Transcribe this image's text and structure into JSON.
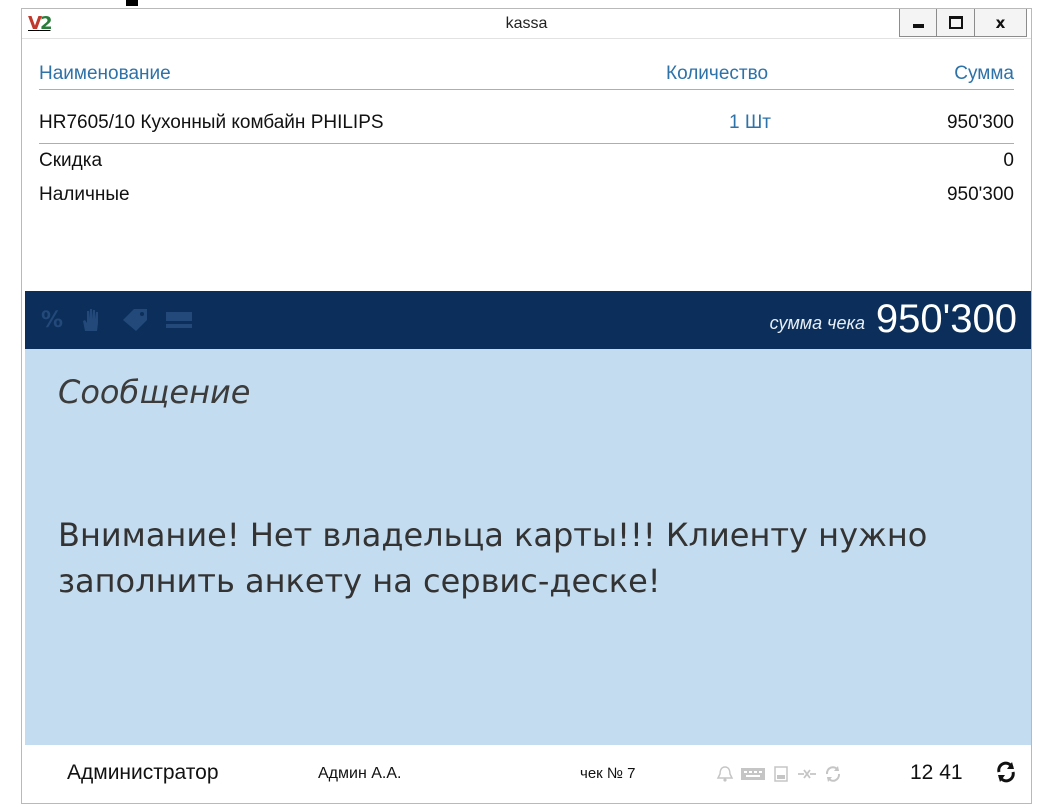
{
  "window": {
    "title": "kassa",
    "app_icon_text": "V2",
    "close_label": "x"
  },
  "table": {
    "headers": {
      "name": "Наименование",
      "quantity": "Количество",
      "sum": "Сумма"
    },
    "rows": [
      {
        "name": "HR7605/10 Кухонный комбайн PHILIPS",
        "quantity": "1 Шт",
        "sum": "950'300"
      },
      {
        "name": "Скидка",
        "quantity": "",
        "sum": "0"
      },
      {
        "name": "Наличные",
        "quantity": "",
        "sum": "950'300"
      }
    ]
  },
  "status_bar": {
    "icons": [
      "percent-icon",
      "hand-icon",
      "discount-tag-icon",
      "card-icon"
    ],
    "percent_glyph": "%",
    "total_label": "сумма чека",
    "total_value": "950'300"
  },
  "message": {
    "title": "Сообщение",
    "text": "Внимание! Нет владельца карты!!! Клиенту нужно заполнить анкету на сервис-деске!"
  },
  "footer": {
    "role": "Администратор",
    "user": "Админ А.А.",
    "check": "чек № 7",
    "device_icons": [
      "bell-icon",
      "keyboard-icon",
      "printer-icon",
      "network-icon",
      "sync-small-icon"
    ],
    "time": "12 41",
    "sync_icon": "sync-icon"
  },
  "colors": {
    "header_blue": "#2d72a8",
    "status_bar_bg": "#0b2f5a",
    "message_bg": "#c4dcef"
  }
}
